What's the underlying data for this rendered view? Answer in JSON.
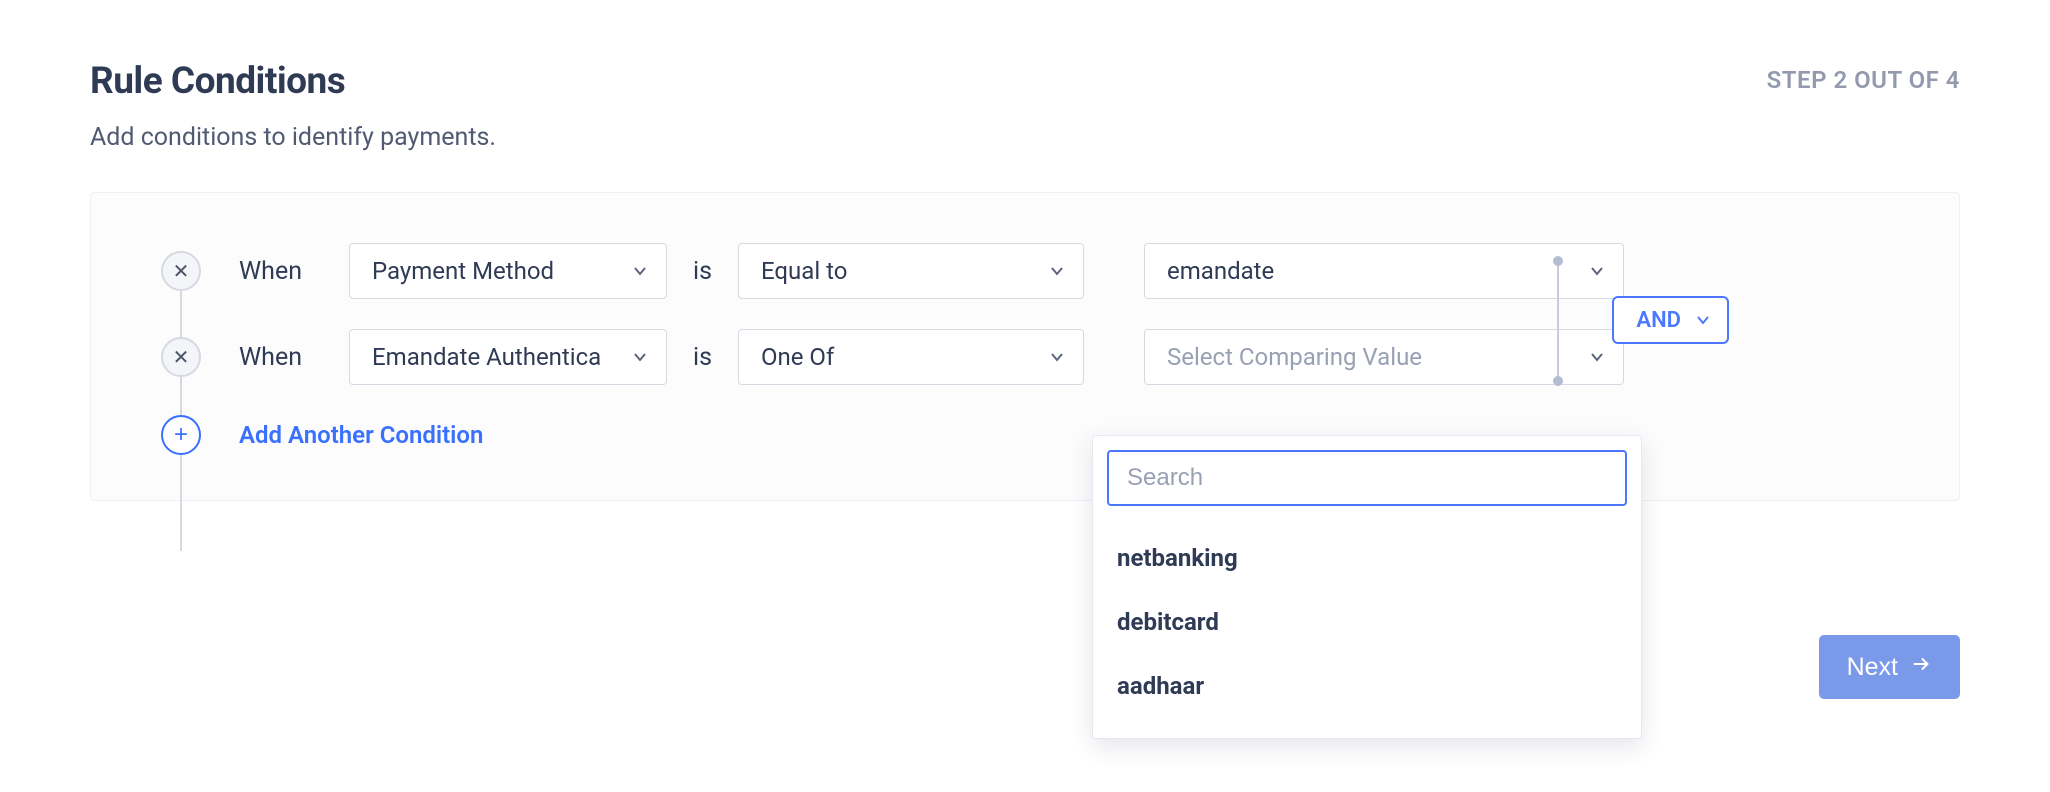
{
  "header": {
    "title": "Rule Conditions",
    "step": "STEP 2 OUT OF 4",
    "subtitle": "Add conditions to identify payments."
  },
  "labels": {
    "when": "When",
    "is": "is",
    "add_condition": "Add Another Condition",
    "next": "Next"
  },
  "join": {
    "operator": "AND"
  },
  "conditions": [
    {
      "field": "Payment Method",
      "operator": "Equal to",
      "value": "emandate",
      "value_placeholder": ""
    },
    {
      "field": "Emandate Authentica",
      "operator": "One Of",
      "value": "",
      "value_placeholder": "Select Comparing Value"
    }
  ],
  "dropdown": {
    "search_placeholder": "Search",
    "options": [
      "netbanking",
      "debitcard",
      "aadhaar"
    ]
  }
}
